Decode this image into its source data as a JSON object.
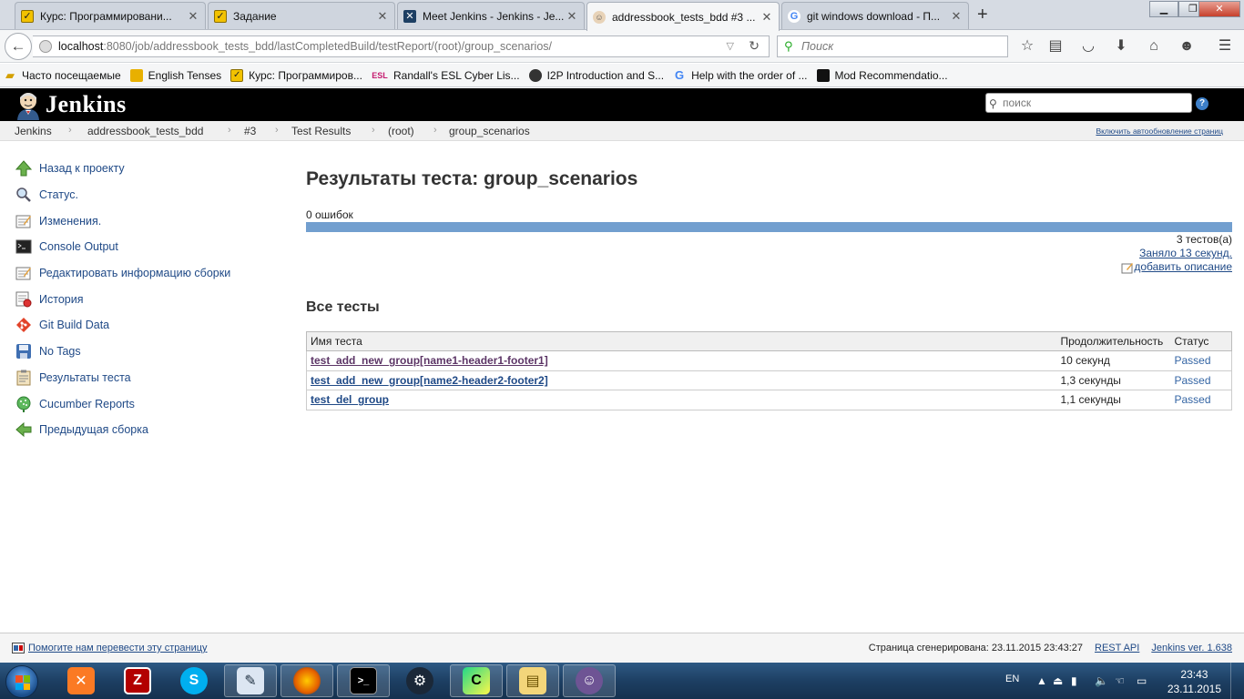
{
  "browser": {
    "tabs": [
      {
        "title": "Курс: Программировани...",
        "icon": "checkbox-icon"
      },
      {
        "title": "Задание",
        "icon": "checkbox-icon"
      },
      {
        "title": "Meet Jenkins - Jenkins - Je...",
        "icon": "jenkins-icon"
      },
      {
        "title": "addressbook_tests_bdd #3 ...",
        "icon": "jenkins-butler-icon"
      },
      {
        "title": "git windows download - П...",
        "icon": "google-icon"
      }
    ],
    "url_host": "localhost",
    "url_rest": ":8080/job/addressbook_tests_bdd/lastCompletedBuild/testReport/(root)/group_scenarios/",
    "search_placeholder": "Поиск",
    "bookmarks": [
      {
        "label": "Часто посещаемые"
      },
      {
        "label": "English Tenses"
      },
      {
        "label": "Курс: Программиров..."
      },
      {
        "label": "Randall's ESL Cyber Lis..."
      },
      {
        "label": "I2P Introduction and S..."
      },
      {
        "label": "Help with the order of ..."
      },
      {
        "label": "Mod Recommendatio..."
      }
    ],
    "bookmark_icon_text": {
      "esl": "ESL",
      "google": "G"
    }
  },
  "jenkins": {
    "brand": "Jenkins",
    "search_placeholder": "поиск",
    "help_label": "?",
    "breadcrumbs": [
      "Jenkins",
      "addressbook_tests_bdd",
      "#3",
      "Test Results",
      "(root)",
      "group_scenarios"
    ],
    "auto_refresh": "Включить автообновление страниц",
    "sidebar": [
      {
        "label": "Назад к проекту",
        "icon": "up-arrow-icon"
      },
      {
        "label": "Статус.",
        "icon": "magnifier-icon"
      },
      {
        "label": "Изменения.",
        "icon": "notepad-icon"
      },
      {
        "label": "Console Output",
        "icon": "terminal-icon"
      },
      {
        "label": "Редактировать информацию сборки",
        "icon": "notepad-icon"
      },
      {
        "label": "История",
        "icon": "history-icon"
      },
      {
        "label": "Git Build Data",
        "icon": "git-icon"
      },
      {
        "label": "No Tags",
        "icon": "save-icon"
      },
      {
        "label": "Результаты теста",
        "icon": "clipboard-icon"
      },
      {
        "label": "Cucumber Reports",
        "icon": "cucumber-icon"
      },
      {
        "label": "Предыдущая сборка",
        "icon": "left-arrow-icon"
      }
    ],
    "main": {
      "title": "Результаты теста: group_scenarios",
      "fail_count": "0 ошибок",
      "pass_fraction": 1.0,
      "test_count": "3 тестов(а)",
      "duration": "Заняло 13 секунд.",
      "add_description": "добавить описание",
      "all_tests_title": "Все тесты",
      "table": {
        "headers": [
          "Имя теста",
          "Продолжительность",
          "Статус"
        ],
        "rows": [
          {
            "name": "test_add_new_group[name1-header1-footer1]",
            "duration": "10 секунд",
            "status": "Passed"
          },
          {
            "name": "test_add_new_group[name2-header2-footer2]",
            "duration": "1,3 секунды",
            "status": "Passed"
          },
          {
            "name": "test_del_group",
            "duration": "1,1 секунды",
            "status": "Passed"
          }
        ]
      }
    },
    "footer": {
      "translate_link": "Помогите нам перевести эту страницу",
      "generated": "Страница сгенерирована: 23.11.2015 23:43:27",
      "rest_api": "REST API",
      "version": "Jenkins ver. 1.638"
    }
  },
  "taskbar": {
    "lang": "EN",
    "time": "23:43",
    "date": "23.11.2015",
    "apps": [
      "xampp-icon",
      "filezilla-icon",
      "skype-icon",
      "editor-icon",
      "firefox-icon",
      "cmd-icon",
      "steam-icon",
      "pycharm-icon",
      "folder-icon",
      "github-icon"
    ]
  }
}
